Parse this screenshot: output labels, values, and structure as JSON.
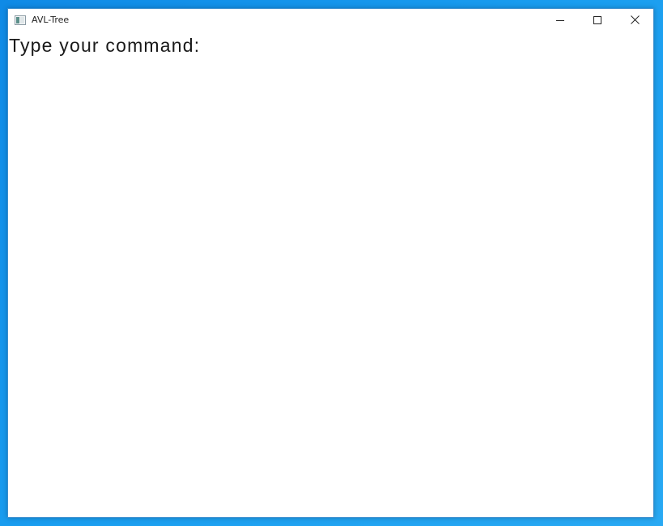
{
  "window": {
    "title": "AVL-Tree",
    "icon": "app-window-icon",
    "controls": {
      "minimize_icon": "minimize-icon",
      "maximize_icon": "maximize-icon",
      "close_icon": "close-icon"
    }
  },
  "content": {
    "prompt": "Type your command:"
  },
  "colors": {
    "desktop": "#1a9ef0",
    "window_border": "#3b8fd0",
    "window_bg": "#ffffff",
    "text": "#1a1a1a"
  }
}
